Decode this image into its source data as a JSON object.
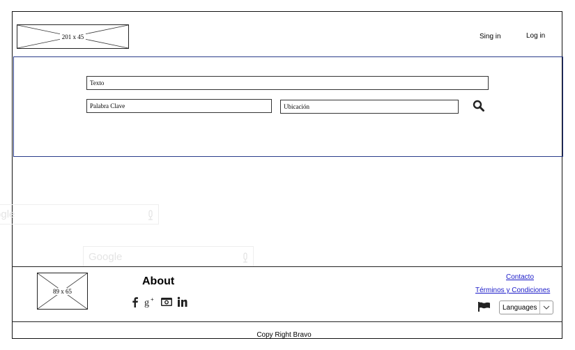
{
  "header": {
    "logo_placeholder": "201 x 45",
    "signup_label": "Sing in",
    "login_label": "Log in"
  },
  "search": {
    "text_value": "Texto",
    "keyword_value": "Palabra Clave",
    "location_value": "Ubicación",
    "search_icon": "magnifier-icon"
  },
  "ghost_search": {
    "label": "Google"
  },
  "footer": {
    "logo_placeholder": "89 x 65",
    "about_title": "About",
    "social_icons": [
      "facebook-icon",
      "google-plus-icon",
      "instagram-icon",
      "linkedin-icon"
    ],
    "contact_label": "Contacto",
    "terms_label": "Términos y Condiciones",
    "language_label": "Languages",
    "copyright": "Copy Right Bravo"
  },
  "colors": {
    "hero_border": "#2a3c8a",
    "link": "#1a1ac8"
  }
}
